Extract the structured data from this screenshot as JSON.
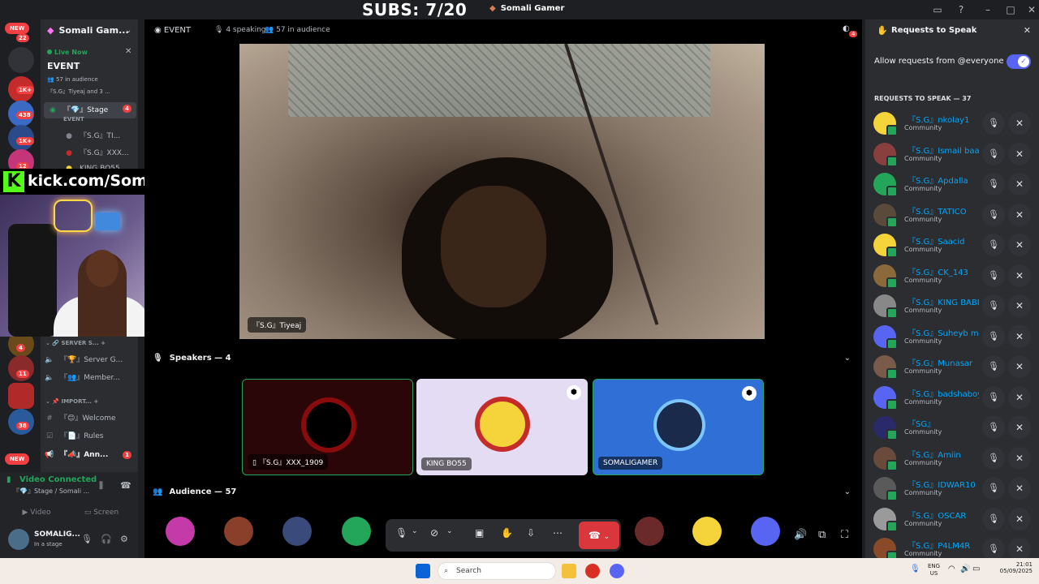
{
  "titlebar": {
    "overlay_text": "SUBS: 7/20",
    "app_title": "Somali Gamer"
  },
  "rail": {
    "new_top": "NEW",
    "new_bottom": "NEW",
    "badges": [
      "22",
      "1K+",
      "438",
      "1K+",
      "12",
      "4",
      "11",
      "38"
    ]
  },
  "sidebar": {
    "server_name": "Somali Gam...",
    "live_now": "Live Now",
    "event_name": "EVENT",
    "audience_small": "57 in audience",
    "speakers_small": "『S.G』Tiyeaj and 3 ...",
    "stage_channel": "『💎』Stage",
    "stage_badge": "4",
    "stage_sub": "EVENT",
    "stage_members": [
      "『S.G』TI...",
      "『S.G』XXX...",
      "KING BO55"
    ],
    "cat1": "SERVER S...",
    "cat1_channels": [
      "『🏆』Server G...",
      "『👥』Member..."
    ],
    "cat2": "IMPORT...",
    "cat2_channels": [
      "『😊』Welcome",
      "『📄』Rules",
      "『📣』Ann..."
    ],
    "ann_badge": "1"
  },
  "overlay": {
    "kick_url": "kick.com/SomaliGamer"
  },
  "stage": {
    "header_event": "EVENT",
    "header_speaking": "4 speaking",
    "header_audience": "57 in audience",
    "notif_badge": "4",
    "main_video_label": "『S.G』Tiyeaj",
    "speakers_header": "Speakers — 4",
    "speakers": [
      {
        "name": "『S.G』XXX_1909",
        "bg": "#2a0608"
      },
      {
        "name": "KING BO55",
        "bg": "#e3dcf2"
      },
      {
        "name": "SOMALIGAMER",
        "bg": "#2f6fd6"
      }
    ],
    "audience_header": "Audience — 57"
  },
  "voice": {
    "status": "Video Connected",
    "channel": "『💎』Stage / Somali ...",
    "video_btn": "Video",
    "screen_btn": "Screen",
    "user_name": "SOMALIG...",
    "user_status": "In a stage"
  },
  "requests": {
    "title": "Requests to Speak",
    "allow_label": "Allow requests from @everyone",
    "count_label": "REQUESTS TO SPEAK — 37",
    "role": "Community",
    "items": [
      {
        "name": "『S.G』nkolay1",
        "color": "#f5d33a"
      },
      {
        "name": "『S.G』Ismail baa...",
        "color": "#8a3f3f"
      },
      {
        "name": "『S.G』Apdalla",
        "color": "#23a55a"
      },
      {
        "name": "『S.G』TATICO",
        "color": "#5a4a3a"
      },
      {
        "name": "『S.G』Saacid",
        "color": "#f5d33a"
      },
      {
        "name": "『S.G』CK_143",
        "color": "#8a6a3a"
      },
      {
        "name": "『S.G』KING BABI",
        "color": "#888888"
      },
      {
        "name": "『S.G』Suheyb m...",
        "color": "#5865f2"
      },
      {
        "name": "『S.G』Munasar",
        "color": "#7a5a4a"
      },
      {
        "name": "『S.G』badshaboy",
        "color": "#5865f2"
      },
      {
        "name": "『SG』",
        "color": "#2a2a6a"
      },
      {
        "name": "『S.G』Amiin",
        "color": "#6a4a3a"
      },
      {
        "name": "『S.G』IDWAR10",
        "color": "#5a5a5a"
      },
      {
        "name": "『S.G』OSCAR",
        "color": "#9a9a9a"
      },
      {
        "name": "『S.G』P4LM4R",
        "color": "#8a4a2a"
      }
    ]
  },
  "taskbar": {
    "search": "Search",
    "lang": "ENG",
    "region": "US",
    "time": "21:01",
    "date": "05/09/2025"
  }
}
